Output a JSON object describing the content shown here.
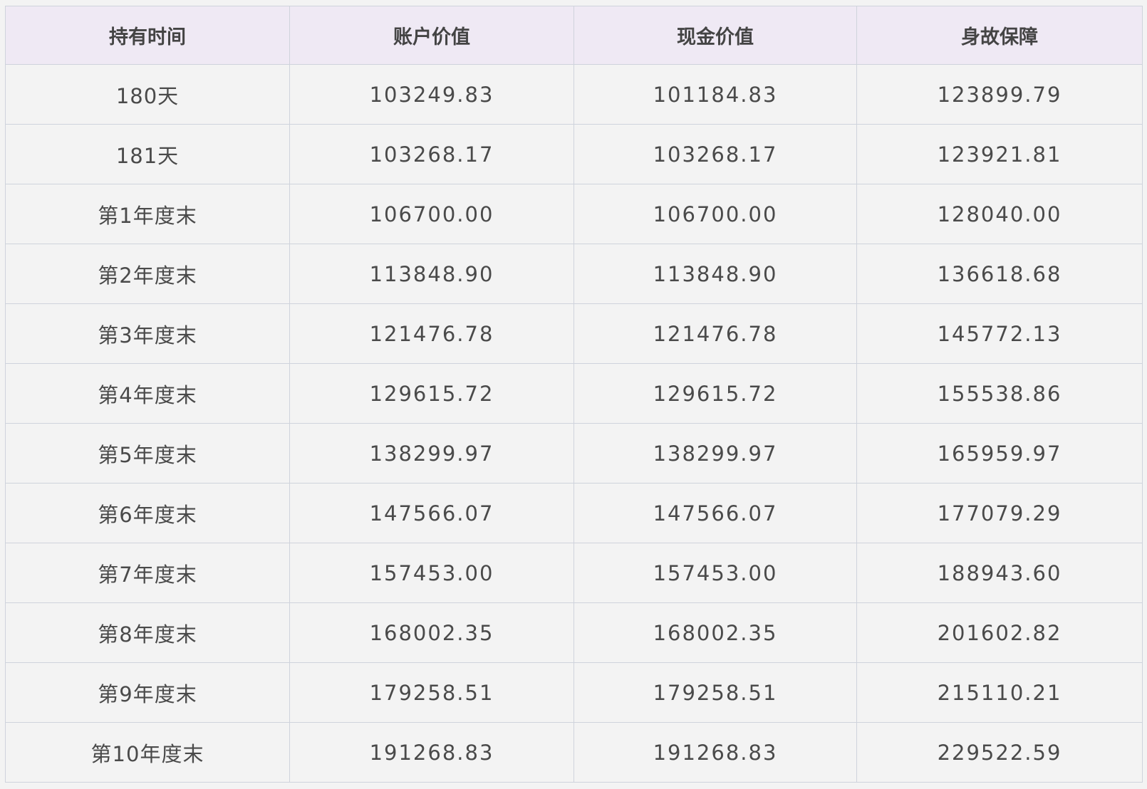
{
  "table": {
    "headers": [
      "持有时间",
      "账户价值",
      "现金价值",
      "身故保障"
    ],
    "rows": [
      [
        "180天",
        "103249.83",
        "101184.83",
        "123899.79"
      ],
      [
        "181天",
        "103268.17",
        "103268.17",
        "123921.81"
      ],
      [
        "第1年度末",
        "106700.00",
        "106700.00",
        "128040.00"
      ],
      [
        "第2年度末",
        "113848.90",
        "113848.90",
        "136618.68"
      ],
      [
        "第3年度末",
        "121476.78",
        "121476.78",
        "145772.13"
      ],
      [
        "第4年度末",
        "129615.72",
        "129615.72",
        "155538.86"
      ],
      [
        "第5年度末",
        "138299.97",
        "138299.97",
        "165959.97"
      ],
      [
        "第6年度末",
        "147566.07",
        "147566.07",
        "177079.29"
      ],
      [
        "第7年度末",
        "157453.00",
        "157453.00",
        "188943.60"
      ],
      [
        "第8年度末",
        "168002.35",
        "168002.35",
        "201602.82"
      ],
      [
        "第9年度末",
        "179258.51",
        "179258.51",
        "215110.21"
      ],
      [
        "第10年度末",
        "191268.83",
        "191268.83",
        "229522.59"
      ]
    ]
  },
  "colors": {
    "header_bg": "#efe9f4",
    "cell_bg": "#f3f3f3",
    "border": "#cfd3dc",
    "text": "#4a4a4a"
  }
}
